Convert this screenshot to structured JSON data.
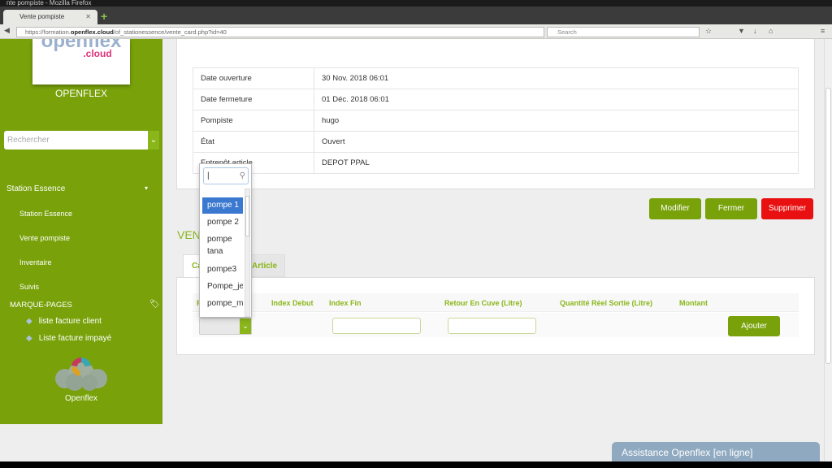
{
  "browser": {
    "window_title": "nte pompiste - Mozilla Firefox",
    "tab_title": "Vente pompiste",
    "url_prefix": "https://formation.",
    "url_domain": "openflex.cloud",
    "url_path": "/of_stationessence/vente_card.php?id=40",
    "search_placeholder": "Search"
  },
  "sidebar": {
    "logo_text": "openflex",
    "logo_sub": ".cloud",
    "brand": "OPENFLEX",
    "search_placeholder": "Rechercher",
    "section": "Station Essence",
    "items": [
      {
        "label": "Station Essence"
      },
      {
        "label": "Vente pompiste"
      },
      {
        "label": "Inventaire"
      },
      {
        "label": "Suivis"
      }
    ],
    "bookmarks_title": "MARQUE-PAGES",
    "bookmarks": [
      {
        "label": "liste facture client"
      },
      {
        "label": "Liste facture impayé"
      }
    ],
    "footer_logo_label": "Openflex",
    "color": "#78a10a"
  },
  "info": [
    {
      "label": "Date ouverture",
      "value": "30 Nov. 2018 06:01"
    },
    {
      "label": "Date fermeture",
      "value": "01 Déc. 2018 06:01"
    },
    {
      "label": "Pompiste",
      "value": "hugo"
    },
    {
      "label": "État",
      "value": "Ouvert"
    },
    {
      "label": "Entrepôt article",
      "value": "DEPOT PPAL"
    }
  ],
  "actions": {
    "modify": "Modifier",
    "close": "Fermer",
    "delete": "Supprimer",
    "delete_color": "#e81010"
  },
  "section_title": "VENTE",
  "tabs": [
    {
      "label": "Ca"
    },
    {
      "label": "Article"
    }
  ],
  "table": {
    "headers": [
      "P",
      "Index Debut",
      "Index Fin",
      "Retour En Cuve (Litre)",
      "Quantité Réel Sortie (Litre)",
      "Montant"
    ],
    "add_button": "Ajouter"
  },
  "dropdown": {
    "search_value": "|",
    "options": [
      "pompe 1",
      "pompe 2",
      "pompe tana",
      "pompe3",
      "Pompe_je",
      "pompe_m",
      "pompe_m"
    ],
    "selected": "pompe 1"
  },
  "assist": "Assistance Openflex [en ligne]"
}
